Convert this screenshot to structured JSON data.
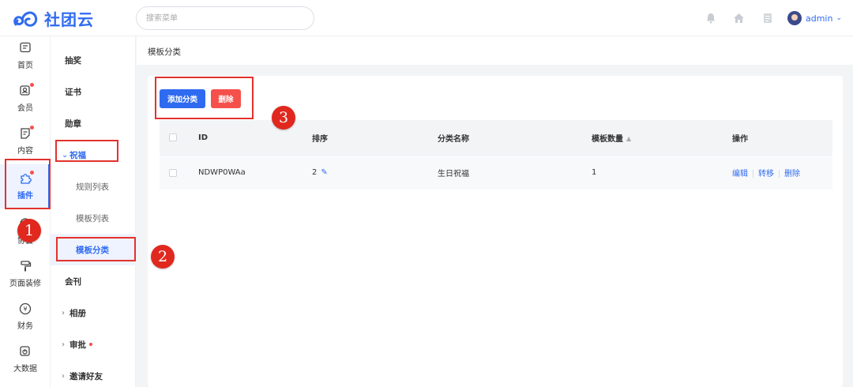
{
  "app": {
    "name": "社团云",
    "brand_color": "#2f6bf0"
  },
  "search": {
    "placeholder": "搜索菜单"
  },
  "user": {
    "name": "admin"
  },
  "top_icons": [
    "bell-icon",
    "home-icon",
    "document-icon"
  ],
  "rail": [
    {
      "label": "首页",
      "icon": "home-screen-icon",
      "badge": false
    },
    {
      "label": "会员",
      "icon": "member-icon",
      "badge": true
    },
    {
      "label": "内容",
      "icon": "content-icon",
      "badge": true
    },
    {
      "label": "插件",
      "icon": "puzzle-icon",
      "badge": true,
      "active": true
    },
    {
      "label": "协会",
      "icon": "association-icon",
      "badge": false
    },
    {
      "label": "页面装修",
      "icon": "paint-roller-icon",
      "badge": false
    },
    {
      "label": "财务",
      "icon": "yen-icon",
      "badge": false
    },
    {
      "label": "大数据",
      "icon": "data-icon",
      "badge": false
    }
  ],
  "submenu": [
    {
      "label": "抽奖"
    },
    {
      "label": "证书"
    },
    {
      "label": "勋章"
    },
    {
      "label": "祝福",
      "expanded": true
    },
    {
      "label": "规则列表",
      "child": true
    },
    {
      "label": "模板列表",
      "child": true
    },
    {
      "label": "模板分类",
      "child": true,
      "selected": true
    },
    {
      "label": "会刊"
    },
    {
      "label": "相册",
      "collapsed": true
    },
    {
      "label": "审批",
      "collapsed": true,
      "badge": true
    },
    {
      "label": "邀请好友",
      "collapsed": true
    }
  ],
  "breadcrumb": "模板分类",
  "toolbar": {
    "add_label": "添加分类",
    "delete_label": "删除"
  },
  "table": {
    "headers": {
      "id": "ID",
      "sort": "排序",
      "name": "分类名称",
      "count": "模板数量",
      "ops": "操作"
    },
    "rows": [
      {
        "id": "NDWP0WAa",
        "sort": "2",
        "name": "生日祝福",
        "count": "1",
        "ops": [
          "编辑",
          "转移",
          "删除"
        ]
      }
    ]
  },
  "annotations": {
    "b1": "1",
    "b2": "2",
    "b3": "3",
    "color": "#e0281f"
  }
}
